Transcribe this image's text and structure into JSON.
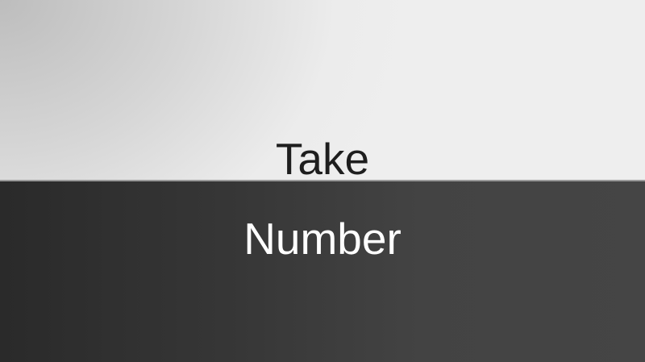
{
  "slide": {
    "title": "Take",
    "subtitle": "Number"
  },
  "colors": {
    "top_background": "#eeeeee",
    "bottom_background": "#3c3c3c",
    "title_text": "#1e1e1e",
    "subtitle_text": "#ffffff"
  }
}
